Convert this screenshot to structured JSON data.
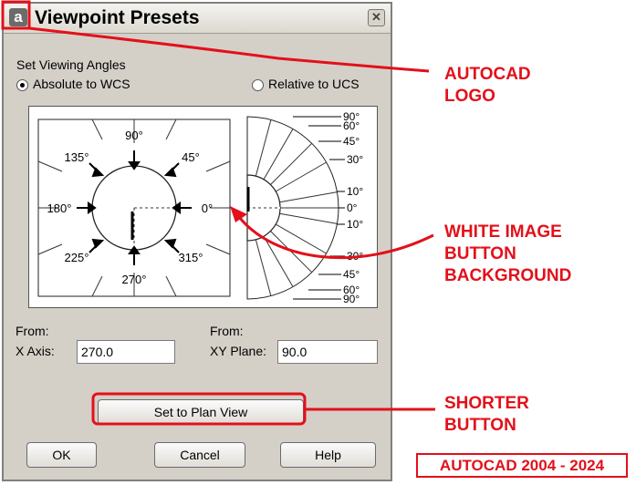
{
  "dialog": {
    "title": "Viewpoint Presets",
    "logo_letter": "a",
    "close_symbol": "✕",
    "section_label": "Set Viewing Angles",
    "radio_absolute": "Absolute to WCS",
    "radio_relative": "Relative to UCS",
    "selected_radio": "Absolute to WCS",
    "compass_angles": [
      "90°",
      "45°",
      "0°",
      "315°",
      "270°",
      "225°",
      "180°",
      "135°"
    ],
    "elevation_angles": [
      "90°",
      "60°",
      "45°",
      "30°",
      "10°",
      "0°",
      "10°",
      "30°",
      "45°",
      "60°",
      "90°"
    ],
    "from_label_1": "From:",
    "x_axis_label": "X Axis:",
    "x_axis_value": "270.0",
    "from_label_2": "From:",
    "xy_plane_label": "XY Plane:",
    "xy_plane_value": "90.0",
    "plan_view_button": "Set to Plan View",
    "ok_button": "OK",
    "cancel_button": "Cancel",
    "help_button": "Help"
  },
  "annotations": {
    "logo_line1": "AUTOCAD",
    "logo_line2": "LOGO",
    "image_line1": "WHITE IMAGE",
    "image_line2": "BUTTON",
    "image_line3": "BACKGROUND",
    "button_line1": "SHORTER",
    "button_line2": "BUTTON",
    "version_badge": "AUTOCAD 2004 - 2024"
  },
  "colors": {
    "annotation_red": "#e3101a",
    "dialog_bg": "#d4d0c8"
  }
}
